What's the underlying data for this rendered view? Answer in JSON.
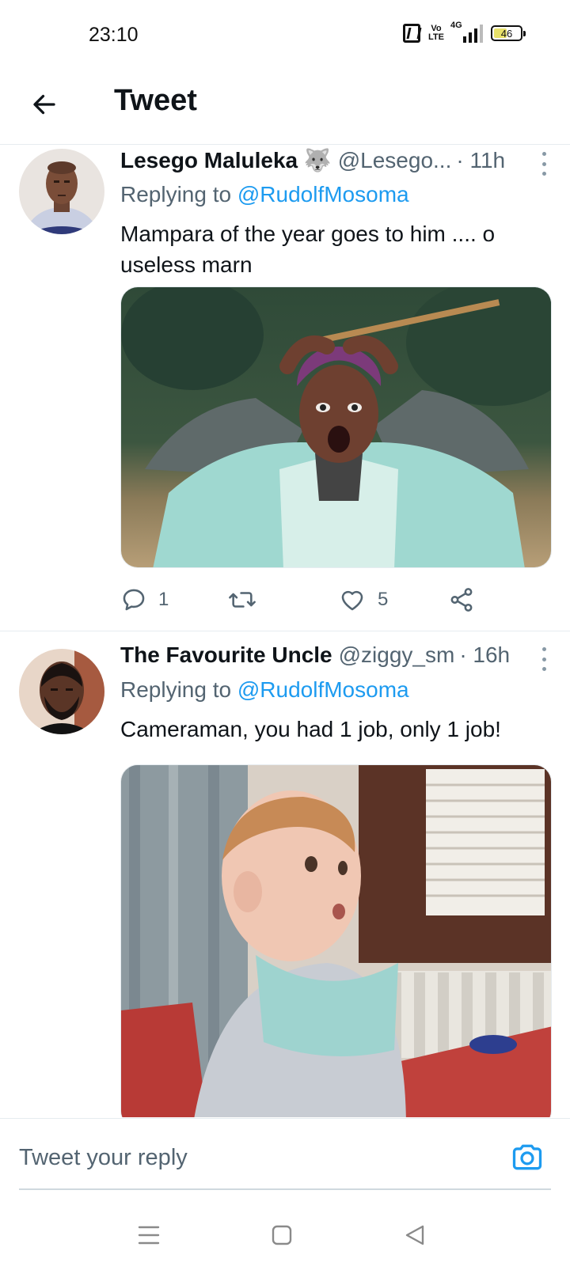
{
  "status_bar": {
    "time": "23:10",
    "volte_top": "Vo",
    "volte_bottom": "LTE",
    "network": "4G",
    "battery": "46"
  },
  "header": {
    "back_icon": "arrow-left-icon",
    "title": "Tweet"
  },
  "tweets": [
    {
      "author_name": "Lesego Maluleka 🐺",
      "handle": "@Lesego...",
      "time": "· 11h",
      "replying_prefix": "Replying to",
      "replying_to": "@RudolfMosoma",
      "text": "Mampara  of the year goes to him .... o useless  marn",
      "media_description": "",
      "reply_count": "1",
      "retweet_count": "",
      "like_count": "5"
    },
    {
      "author_name": "The Favourite Uncle",
      "handle": "@ziggy_sm",
      "time": "· 16h",
      "replying_prefix": "Replying to",
      "replying_to": "@RudolfMosoma",
      "text": "Cameraman, you had 1 job, only 1 job!",
      "media_description": ""
    }
  ],
  "reply_bar": {
    "placeholder": "Tweet your reply",
    "camera_icon": "camera-icon"
  },
  "nav_bar": {
    "icons": [
      "menu-icon",
      "home-square-icon",
      "back-triangle-icon"
    ]
  },
  "colors": {
    "accent": "#1d9bf0",
    "secondary_text": "#536471",
    "primary_text": "#0f1419"
  }
}
